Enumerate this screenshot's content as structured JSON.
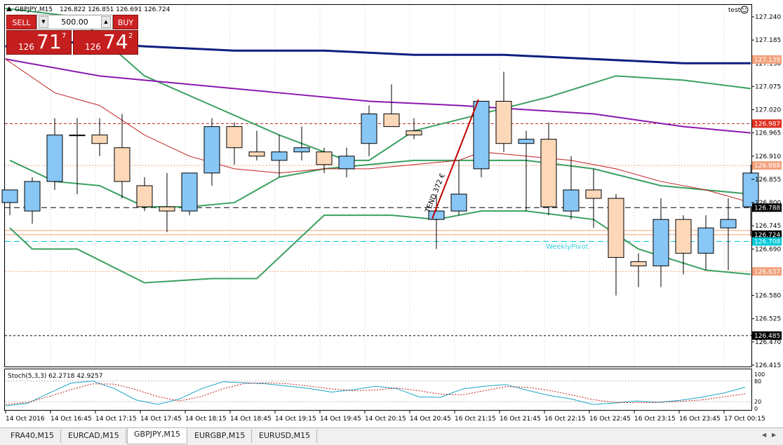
{
  "symbol_title": "GBPJPY,M15",
  "ohlc": "126.822 126.851 126.691 126.724",
  "account_label": "test",
  "trade_panel": {
    "sell_label": "SELL",
    "buy_label": "BUY",
    "lot_value": "500.00",
    "sell_small": "126",
    "sell_big": "71",
    "sell_sup": "7",
    "buy_small": "126",
    "buy_big": "74",
    "buy_sup": "2"
  },
  "axis_ticks": [
    "127.240",
    "127.185",
    "127.130",
    "127.075",
    "127.020",
    "126.965",
    "126.910",
    "126.855",
    "126.800",
    "126.745",
    "126.690",
    "126.635",
    "126.580",
    "126.525",
    "126.470",
    "126.415"
  ],
  "price_labels": [
    {
      "text": "127.139",
      "value": 127.139,
      "color": "#f2a07a"
    },
    {
      "text": "126.987",
      "value": 126.987,
      "color": "#e03020"
    },
    {
      "text": "126.888",
      "value": 126.888,
      "color": "#f2a07a"
    },
    {
      "text": "126.788",
      "value": 126.788,
      "color": "#000000"
    },
    {
      "text": "126.724",
      "value": 126.724,
      "color": "#000000"
    },
    {
      "text": "126.708",
      "value": 126.708,
      "color": "#00c8d8"
    },
    {
      "text": "126.637",
      "value": 126.637,
      "color": "#f2a07a"
    },
    {
      "text": "126.485",
      "value": 126.485,
      "color": "#000000"
    }
  ],
  "time_labels": [
    "14 Oct 2016",
    "14 Oct 16:45",
    "14 Oct 17:15",
    "14 Oct 17:45",
    "14 Oct 18:15",
    "14 Oct 18:45",
    "14 Oct 19:15",
    "14 Oct 19:45",
    "14 Oct 20:15",
    "14 Oct 20:45",
    "16 Oct 21:15",
    "16 Oct 21:45",
    "16 Oct 22:15",
    "16 Oct 22:45",
    "16 Oct 23:15",
    "16 Oct 23:45",
    "17 Oct 00:15"
  ],
  "trend_label": "TEND 372 €",
  "pivot_label": "WeeklyPivot",
  "stoch_title": "Stoch(5,3,3) 62.2718 42.9257",
  "stoch_levels": [
    "100",
    "80",
    "20",
    "0"
  ],
  "tabs": [
    {
      "label": "FRA40,M15",
      "active": false
    },
    {
      "label": "EURCAD,M15",
      "active": false
    },
    {
      "label": "GBPJPY,M15",
      "active": true
    },
    {
      "label": "EURGBP,M15",
      "active": false
    },
    {
      "label": "EURUSD,M15",
      "active": false
    }
  ],
  "colors": {
    "bull_candle": "#87c6f5",
    "bear_candle": "#fcd8b8",
    "bollinger": "#3aa060",
    "ma_slow": "#0d1f80",
    "ma_purple": "#8a18b0",
    "ma_fast": "#c02020",
    "weekly_pivot": "#00c8d8"
  },
  "chart_data": {
    "type": "candlestick",
    "timeframe": "M15",
    "ylim": [
      126.415,
      127.265
    ],
    "candles": [
      {
        "o": 126.8,
        "h": 126.83,
        "l": 126.77,
        "c": 126.83
      },
      {
        "o": 126.78,
        "h": 126.86,
        "l": 126.75,
        "c": 126.85
      },
      {
        "o": 126.85,
        "h": 127.0,
        "l": 126.83,
        "c": 126.96
      },
      {
        "o": 126.96,
        "h": 127.0,
        "l": 126.82,
        "c": 126.96
      },
      {
        "o": 126.96,
        "h": 127.0,
        "l": 126.91,
        "c": 126.94
      },
      {
        "o": 126.93,
        "h": 127.01,
        "l": 126.81,
        "c": 126.85
      },
      {
        "o": 126.84,
        "h": 126.86,
        "l": 126.78,
        "c": 126.79
      },
      {
        "o": 126.79,
        "h": 126.87,
        "l": 126.73,
        "c": 126.78
      },
      {
        "o": 126.78,
        "h": 126.87,
        "l": 126.77,
        "c": 126.87
      },
      {
        "o": 126.87,
        "h": 127.0,
        "l": 126.84,
        "c": 126.98
      },
      {
        "o": 126.98,
        "h": 126.99,
        "l": 126.89,
        "c": 126.93
      },
      {
        "o": 126.92,
        "h": 126.97,
        "l": 126.9,
        "c": 126.91
      },
      {
        "o": 126.9,
        "h": 126.96,
        "l": 126.86,
        "c": 126.92
      },
      {
        "o": 126.92,
        "h": 126.98,
        "l": 126.9,
        "c": 126.93
      },
      {
        "o": 126.92,
        "h": 126.93,
        "l": 126.87,
        "c": 126.89
      },
      {
        "o": 126.88,
        "h": 126.93,
        "l": 126.86,
        "c": 126.91
      },
      {
        "o": 126.94,
        "h": 127.03,
        "l": 126.91,
        "c": 127.01
      },
      {
        "o": 127.01,
        "h": 127.08,
        "l": 126.98,
        "c": 126.98
      },
      {
        "o": 126.97,
        "h": 127.0,
        "l": 126.95,
        "c": 126.96
      },
      {
        "o": 126.76,
        "h": 126.82,
        "l": 126.69,
        "c": 126.78
      },
      {
        "o": 126.78,
        "h": 126.9,
        "l": 126.77,
        "c": 126.82
      },
      {
        "o": 126.88,
        "h": 127.04,
        "l": 126.86,
        "c": 127.04
      },
      {
        "o": 127.04,
        "h": 127.11,
        "l": 126.92,
        "c": 126.94
      },
      {
        "o": 126.94,
        "h": 126.97,
        "l": 126.78,
        "c": 126.95
      },
      {
        "o": 126.95,
        "h": 126.99,
        "l": 126.77,
        "c": 126.79
      },
      {
        "o": 126.78,
        "h": 126.91,
        "l": 126.76,
        "c": 126.83
      },
      {
        "o": 126.83,
        "h": 126.88,
        "l": 126.74,
        "c": 126.81
      },
      {
        "o": 126.81,
        "h": 126.82,
        "l": 126.58,
        "c": 126.67
      },
      {
        "o": 126.66,
        "h": 126.68,
        "l": 126.6,
        "c": 126.65
      },
      {
        "o": 126.65,
        "h": 126.81,
        "l": 126.6,
        "c": 126.76
      },
      {
        "o": 126.76,
        "h": 126.77,
        "l": 126.63,
        "c": 126.68
      },
      {
        "o": 126.68,
        "h": 126.77,
        "l": 126.64,
        "c": 126.74
      },
      {
        "o": 126.74,
        "h": 126.81,
        "l": 126.64,
        "c": 126.76
      },
      {
        "o": 126.79,
        "h": 126.89,
        "l": 126.72,
        "c": 126.87
      }
    ],
    "series": [
      {
        "name": "Stoch",
        "values": [
          8,
          15,
          45,
          74,
          80,
          58,
          25,
          12,
          28,
          58,
          78,
          75,
          72,
          65,
          58,
          48,
          55,
          65,
          58,
          34,
          33,
          57,
          65,
          70,
          53,
          38,
          28,
          12,
          16,
          22,
          18,
          24,
          33,
          45,
          62
        ]
      },
      {
        "name": "Stoch signal",
        "values": [
          12,
          18,
          35,
          55,
          72,
          71,
          55,
          35,
          22,
          35,
          58,
          73,
          75,
          72,
          65,
          57,
          52,
          54,
          60,
          52,
          42,
          40,
          52,
          64,
          62,
          53,
          40,
          26,
          18,
          17,
          18,
          21,
          25,
          34,
          43
        ]
      }
    ]
  }
}
